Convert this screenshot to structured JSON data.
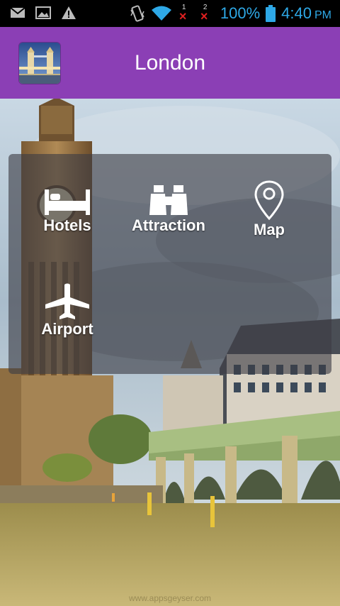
{
  "status_bar": {
    "battery_percent": "100%",
    "time": "4:40",
    "ampm": "PM",
    "sim1": "1",
    "sim2": "2",
    "icons": [
      "gmail-icon",
      "image-icon",
      "warning-icon",
      "vibrate-icon",
      "wifi-icon",
      "sim-no-signal-icon",
      "battery-icon"
    ]
  },
  "app_bar": {
    "title": "London",
    "icon": "tower-bridge-icon",
    "color": "#8b3fb5"
  },
  "menu": {
    "items": [
      {
        "label": "Hotels",
        "icon": "bed-icon"
      },
      {
        "label": "Attraction",
        "icon": "binoculars-icon"
      },
      {
        "label": "Map",
        "icon": "map-pin-icon"
      },
      {
        "label": "Airport",
        "icon": "airplane-icon"
      }
    ]
  },
  "watermark": "www.appsgeyser.com"
}
